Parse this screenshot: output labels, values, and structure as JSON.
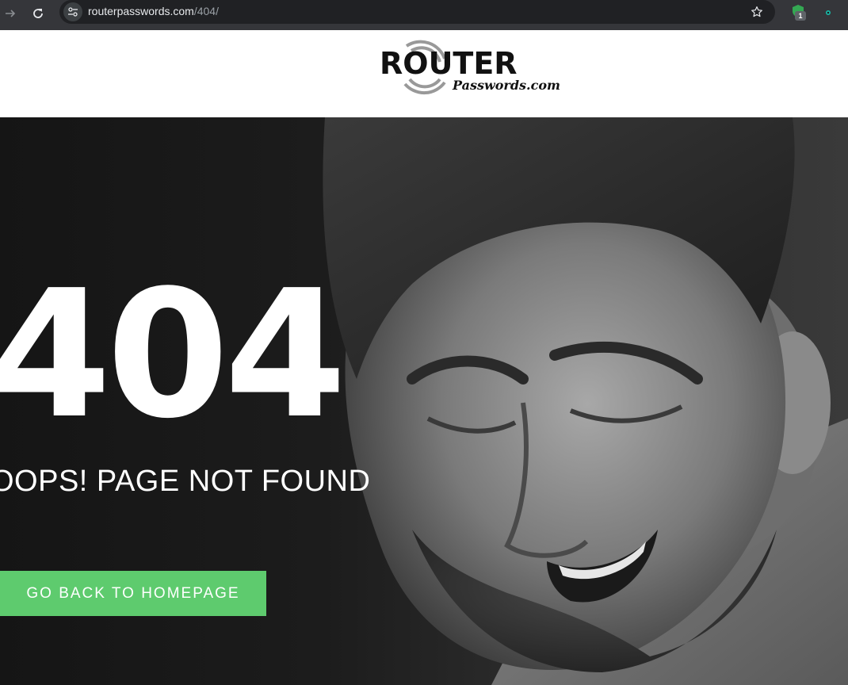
{
  "browser": {
    "url_domain": "routerpasswords.com",
    "url_path": "/404/",
    "extension_badge": "1",
    "icons": [
      "forward-arrow-icon",
      "reload-icon",
      "site-info-icon",
      "star-icon",
      "shield-extension-icon",
      "extension-icon"
    ]
  },
  "header": {
    "logo_word": "ROUTER",
    "logo_script": "Passwords.com"
  },
  "hero": {
    "code": "404",
    "subtitle": "OOPS! PAGE NOT FOUND",
    "button_label": "GO BACK TO HOMEPAGE",
    "button_color": "#5ecb6e"
  }
}
